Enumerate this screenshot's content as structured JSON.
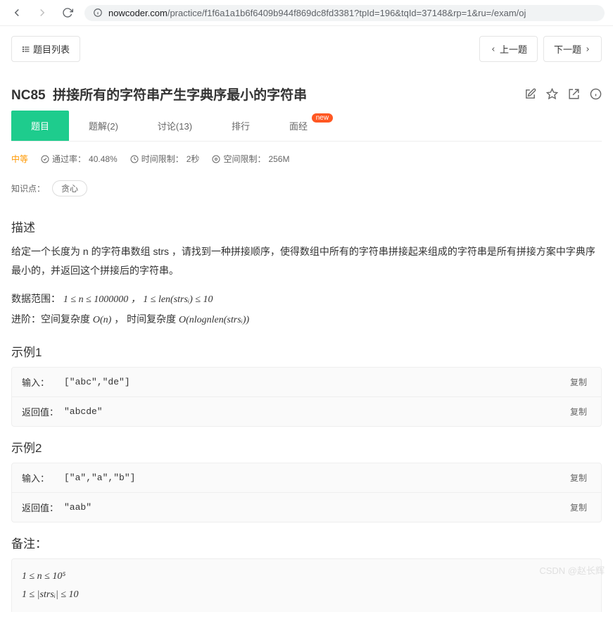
{
  "browser": {
    "url_domain": "nowcoder.com",
    "url_path": "/practice/f1f6a1a1b6f6409b944f869dc8fd3381?tpId=196&tqId=37148&rp=1&ru=/exam/oj"
  },
  "topbar": {
    "list_label": "题目列表",
    "prev_label": "上一题",
    "next_label": "下一题"
  },
  "problem": {
    "code": "NC85",
    "title": "拼接所有的字符串产生字典序最小的字符串"
  },
  "tabs": {
    "problem": "题目",
    "solution": "题解(2)",
    "discuss": "讨论(13)",
    "rank": "排行",
    "experience": "面经",
    "new_badge": "new"
  },
  "meta": {
    "difficulty": "中等",
    "pass_label": "通过率：",
    "pass_value": "40.48%",
    "time_label": "时间限制：",
    "time_value": "2秒",
    "space_label": "空间限制：",
    "space_value": "256M"
  },
  "knowledge": {
    "label": "知识点：",
    "chip": "贪心"
  },
  "sections": {
    "desc_title": "描述",
    "desc_body": "给定一个长度为 n 的字符串数组 strs ，请找到一种拼接顺序，使得数组中所有的字符串拼接起来组成的字符串是所有拼接方案中字典序最小的，并返回这个拼接后的字符串。",
    "range_prefix": "数据范围：",
    "range_math": "1 ≤ n ≤ 1000000 ， 1 ≤ len(strsᵢ) ≤ 10",
    "advance_prefix": "进阶：空间复杂度 ",
    "advance_space": "O(n)",
    "advance_mid": " ， 时间复杂度 ",
    "advance_time": "O(nlognlen(strsᵢ))",
    "ex1_title": "示例1",
    "ex2_title": "示例2",
    "remark_title": "备注：",
    "remark_line1": "1 ≤ n ≤ 10⁵",
    "remark_line2": "1 ≤ |strsᵢ| ≤ 10"
  },
  "examples": {
    "input_label": "输入：",
    "return_label": "返回值：",
    "copy_label": "复制",
    "ex1_input": "[\"abc\",\"de\"]",
    "ex1_return": "\"abcde\"",
    "ex2_input": "[\"a\",\"a\",\"b\"]",
    "ex2_return": "\"aab\""
  },
  "watermark": "CSDN @赵长辉"
}
